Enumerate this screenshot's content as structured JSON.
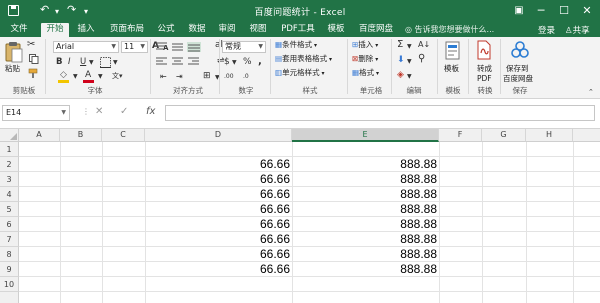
{
  "window": {
    "title": "百度问题统计 - Excel",
    "undo_icon": "↶",
    "redo_icon": "↷",
    "customize_icon": "▾",
    "ribbon_display_icon": "▣",
    "minimize_icon": "─",
    "maximize_icon": "☐",
    "close_icon": "✕"
  },
  "tabs": [
    "文件",
    "开始",
    "插入",
    "页面布局",
    "公式",
    "数据",
    "审阅",
    "视图",
    "PDF工具",
    "模板",
    "百度网盘"
  ],
  "active_tab": "开始",
  "tell_me": "告诉我您想要做什么...",
  "login_label": "登录",
  "share_label": "共享",
  "ribbon": {
    "clipboard": {
      "label": "剪贴板",
      "paste": "粘贴"
    },
    "font": {
      "label": "字体",
      "font_name": "Arial",
      "font_size": "11",
      "bold": "B",
      "italic": "I",
      "underline": "U",
      "grow": "A",
      "shrink": "A",
      "font_color": "A",
      "fill_color": "◇"
    },
    "alignment": {
      "label": "对齐方式",
      "wrap": "⇌",
      "merge": "⊞"
    },
    "number": {
      "label": "数字",
      "format": "常规",
      "currency": "$",
      "percent": "%",
      "comma": ",",
      "inc_decimal": ".00",
      "dec_decimal": ".0"
    },
    "styles": {
      "label": "样式",
      "conditional": "条件格式",
      "table": "套用表格格式",
      "cell_styles": "单元格样式"
    },
    "cells": {
      "label": "单元格",
      "insert": "插入",
      "delete": "删除",
      "format": "格式"
    },
    "editing": {
      "label": "编辑",
      "sum": "Σ",
      "sort": "A↓",
      "find": "⚲",
      "clear": "◈"
    },
    "templates": {
      "label": "模板",
      "button": "模板"
    },
    "convert": {
      "label": "转换",
      "button_line1": "转成",
      "button_line2": "PDF"
    },
    "save": {
      "label": "保存",
      "button_line1": "保存到",
      "button_line2": "百度网盘"
    }
  },
  "formula_bar": {
    "name_box": "E14",
    "cancel": "✕",
    "enter": "✓",
    "fx": "fx",
    "content": ""
  },
  "sheet": {
    "columns": [
      "A",
      "B",
      "C",
      "D",
      "E",
      "F",
      "G",
      "H"
    ],
    "selected_column": "E",
    "rows": [
      "1",
      "2",
      "3",
      "4",
      "5",
      "6",
      "7",
      "8",
      "9",
      "10"
    ],
    "d_values": [
      "",
      "66.66",
      "66.66",
      "66.66",
      "66.66",
      "66.66",
      "66.66",
      "66.66",
      "66.66",
      ""
    ],
    "e_values": [
      "",
      "888.88",
      "888.88",
      "888.88",
      "888.88",
      "888.88",
      "888.88",
      "888.88",
      "888.88",
      ""
    ]
  }
}
